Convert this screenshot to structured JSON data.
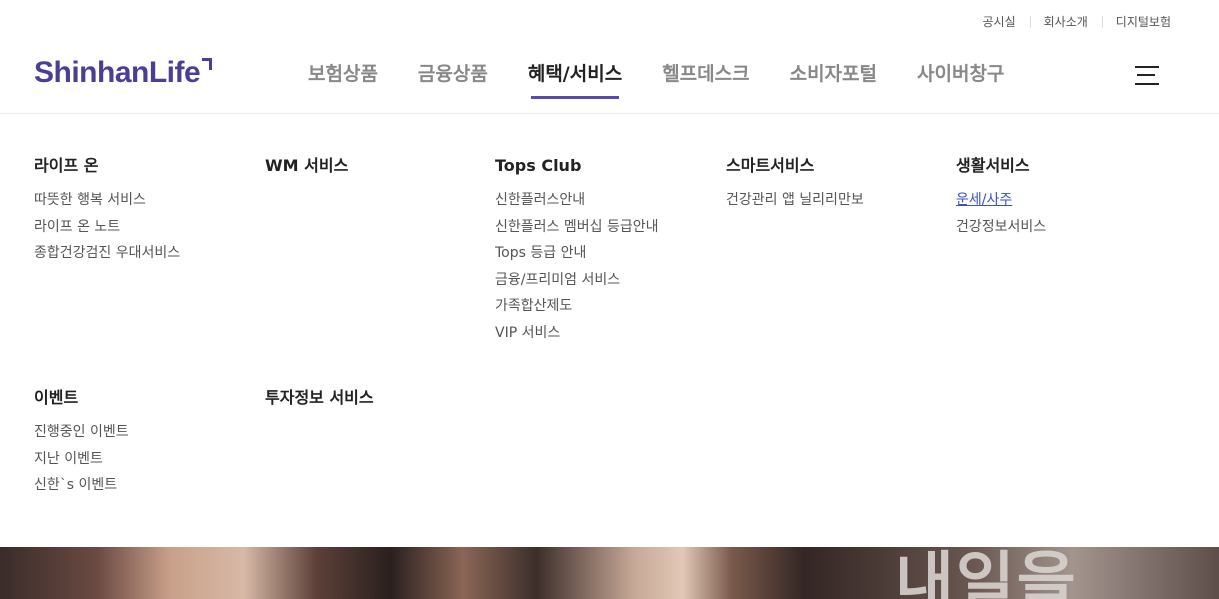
{
  "utility": [
    "공시실",
    "회사소개",
    "디지털보험"
  ],
  "logo": "ShinhanLife",
  "gnb": [
    "보험상품",
    "금융상품",
    "혜택/서비스",
    "헬프데스크",
    "소비자포털",
    "사이버창구"
  ],
  "gnb_active": "혜택/서비스",
  "menu": {
    "life_on": {
      "title": "라이프 온",
      "items": [
        "따뜻한 행복 서비스",
        "라이프 온 노트",
        "종합건강검진 우대서비스"
      ]
    },
    "wm": {
      "title": "WM 서비스",
      "items": []
    },
    "tops": {
      "title": "Tops Club",
      "items": [
        "신한플러스안내",
        "신한플러스 멤버십 등급안내",
        "Tops 등급 안내",
        "금융/프리미엄 서비스",
        "가족합산제도",
        "VIP 서비스"
      ]
    },
    "smart": {
      "title": "스마트서비스",
      "items": [
        "건강관리 앱 닐리리만보"
      ]
    },
    "living": {
      "title": "생활서비스",
      "items": [
        "운세/사주",
        "건강정보서비스"
      ]
    },
    "event": {
      "title": "이벤트",
      "items": [
        "진행중인 이벤트",
        "지난 이벤트",
        "신한`s 이벤트"
      ]
    },
    "invest": {
      "title": "투자정보 서비스",
      "items": []
    }
  },
  "banner_text": "내일을",
  "colors": {
    "brand": "#4a3f94",
    "active_underline": "#5a48b3",
    "link": "#3b52c4"
  }
}
